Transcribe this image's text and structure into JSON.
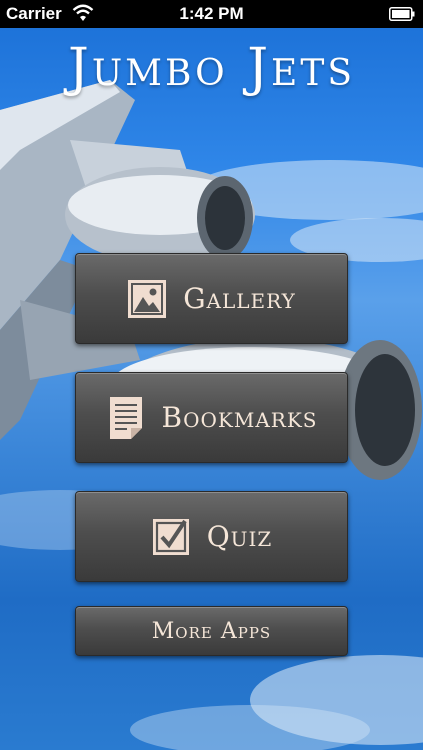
{
  "status_bar": {
    "carrier": "Carrier",
    "time": "1:42 PM",
    "wifi_icon": "wifi-icon",
    "battery_icon": "battery-icon"
  },
  "app": {
    "title": "Jumbo Jets"
  },
  "menu": {
    "gallery": {
      "label": "Gallery",
      "icon": "image-icon"
    },
    "bookmarks": {
      "label": "Bookmarks",
      "icon": "document-icon"
    },
    "quiz": {
      "label": "Quiz",
      "icon": "checkbox-icon"
    },
    "more_apps": {
      "label": "More Apps"
    }
  },
  "colors": {
    "button_label": "#f5e6d8",
    "button_bg": "#4e4e4e",
    "sky": "#2f86e8"
  }
}
